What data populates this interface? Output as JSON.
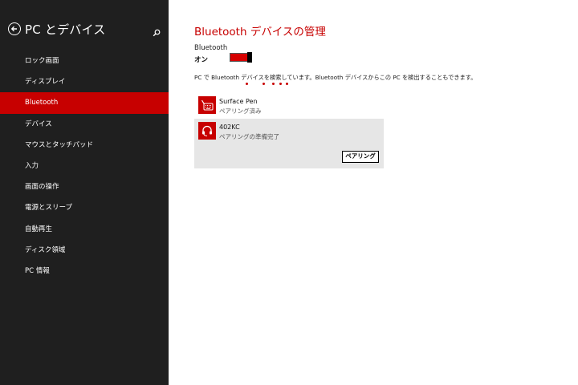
{
  "sidebar": {
    "title": "PC とデバイス",
    "items": [
      {
        "label": "ロック画面"
      },
      {
        "label": "ディスプレイ"
      },
      {
        "label": "Bluetooth"
      },
      {
        "label": "デバイス"
      },
      {
        "label": "マウスとタッチパッド"
      },
      {
        "label": "入力"
      },
      {
        "label": "画面の操作"
      },
      {
        "label": "電源とスリープ"
      },
      {
        "label": "自動再生"
      },
      {
        "label": "ディスク領域"
      },
      {
        "label": "PC 情報"
      }
    ],
    "active_item": "Bluetooth"
  },
  "main": {
    "title": "Bluetooth デバイスの管理",
    "bluetooth_label": "Bluetooth",
    "bluetooth_state": "オン",
    "status_text": "PC で Bluetooth デバイスを検索しています。Bluetooth デバイスからこの PC を検出することもできます。",
    "devices": [
      {
        "name": "Surface Pen",
        "status": "ペアリング済み",
        "icon": "keyboard-pen-icon"
      },
      {
        "name": "402KC",
        "status": "ペアリングの準備完了",
        "icon": "headset-icon",
        "action_label": "ペアリング"
      }
    ]
  },
  "colors": {
    "accent": "#c70000",
    "sidebar_bg": "#1f1f1f",
    "selected_device_bg": "#e6e6e6"
  }
}
